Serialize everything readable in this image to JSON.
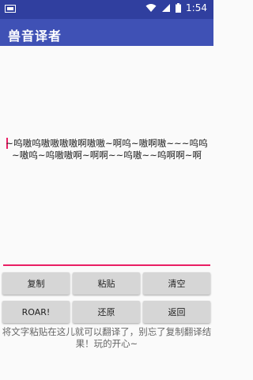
{
  "status_bar": {
    "time": "1:54"
  },
  "app_bar": {
    "title": "兽音译者"
  },
  "editor": {
    "text": "~呜嗷呜嗷嗷嗷嗷啊嗷嗷~啊呜~嗷啊嗷~~~呜呜~嗷呜~呜嗷嗷啊~啊啊~~呜嗷~~呜啊啊~啊"
  },
  "buttons": {
    "copy": "复制",
    "paste": "粘贴",
    "clear": "清空",
    "roar": "ROAR!",
    "restore": "还原",
    "back": "返回"
  },
  "hint": "将文字粘贴在这儿就可以翻译了，别忘了复制翻译结果！玩的开心~",
  "colors": {
    "status_bar": "#303f9f",
    "app_bar": "#3f51b5",
    "accent": "#e91e63",
    "button_bg": "#d6d6d6"
  },
  "icons": [
    "sim-card-icon",
    "wifi-icon",
    "signal-icon",
    "battery-icon"
  ]
}
